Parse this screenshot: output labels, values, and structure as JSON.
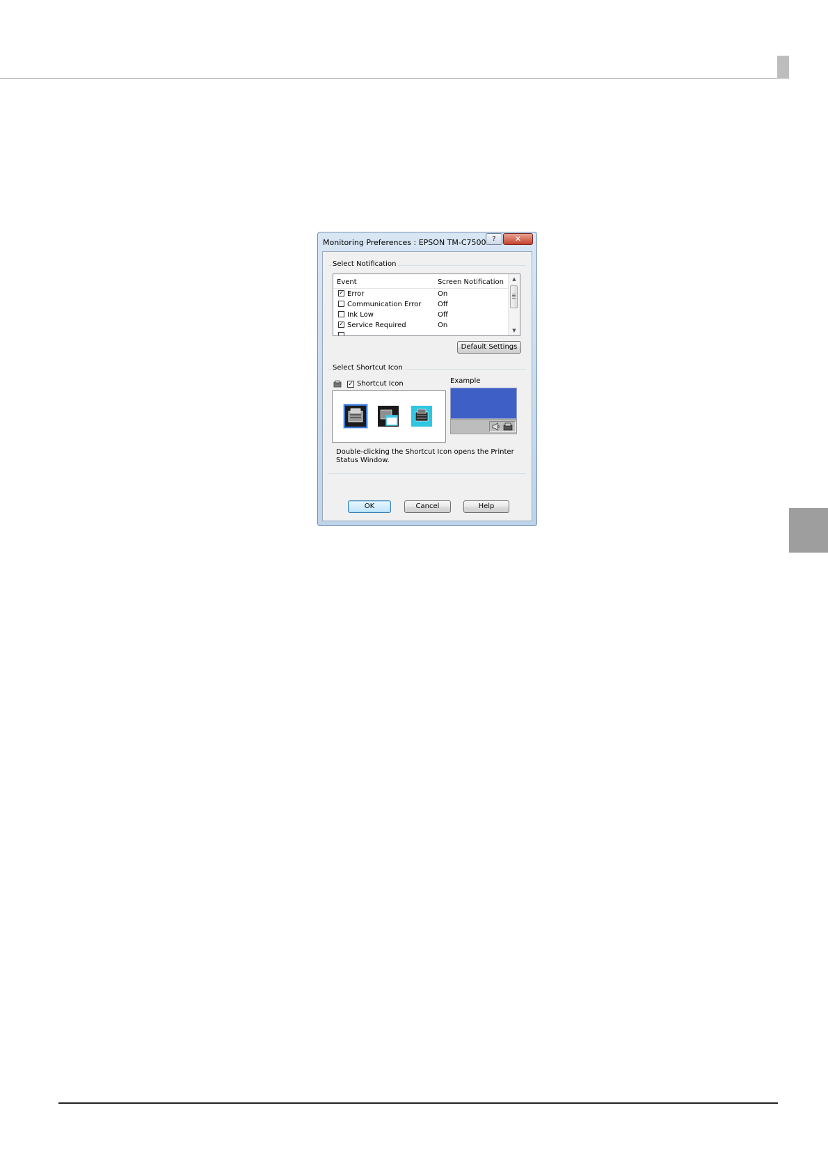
{
  "dialog": {
    "title": "Monitoring Preferences : EPSON TM-C7500",
    "help_glyph": "?",
    "close_glyph": "✕",
    "notification_group_label": "Select Notification",
    "list": {
      "headers": {
        "event": "Event",
        "screen": "Screen Notification"
      },
      "rows": [
        {
          "event": "Error",
          "screen": "On",
          "checked": true
        },
        {
          "event": "Communication Error",
          "screen": "Off",
          "checked": false
        },
        {
          "event": "Ink Low",
          "screen": "Off",
          "checked": false
        },
        {
          "event": "Service Required",
          "screen": "On",
          "checked": true
        }
      ]
    },
    "default_settings_label": "Default Settings",
    "shortcut_group_label": "Select Shortcut Icon",
    "shortcut_checkbox_label": "Shortcut Icon",
    "shortcut_checked": true,
    "example_label": "Example",
    "info_text": "Double-clicking the Shortcut Icon opens the Printer Status Window.",
    "ok_label": "OK",
    "cancel_label": "Cancel",
    "help_label": "Help",
    "check_glyph": "✓",
    "colors": {
      "example_desktop": "#3e5fc5",
      "selected_icon_border": "#3a7bd5"
    }
  }
}
